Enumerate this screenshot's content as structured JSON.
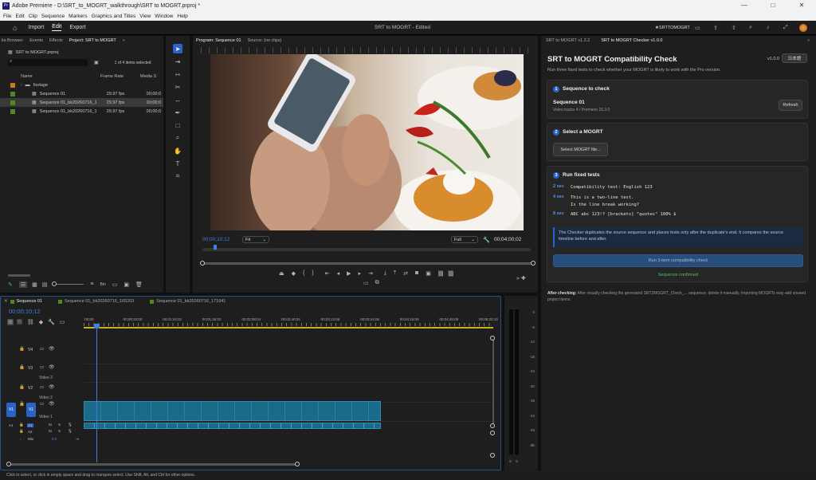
{
  "window": {
    "app": "Adobe Premiere",
    "path": "D:\\SRT_to_MOGRT_walkthrough\\SRT to MOGRT.prproj *",
    "controls": [
      "—",
      "□",
      "✕"
    ]
  },
  "menu": [
    "File",
    "Edit",
    "Clip",
    "Sequence",
    "Markers",
    "Graphics and Titles",
    "View",
    "Window",
    "Help"
  ],
  "header": {
    "workspaces": [
      "Import",
      "Edit",
      "Export"
    ],
    "active_workspace": "Edit",
    "doc_title": "SRT to MOGRT - Edited",
    "right_label": "★SRTTOMOGRT"
  },
  "project": {
    "tabs": [
      "lia Browser",
      "Events",
      "Effects",
      "Project: SRT to MOGRT"
    ],
    "file": "SRT to MOGRT.prproj",
    "selected_count": "1 of 4 items selected",
    "columns": [
      "Name",
      "Frame Rate",
      "Media S"
    ],
    "items": [
      {
        "name": "footage",
        "fps": "",
        "media": "",
        "color": "#c9771b"
      },
      {
        "name": "Sequence 01",
        "fps": "29.97 fps",
        "media": "00;00;0",
        "color": "#4f8a1f"
      },
      {
        "name": "Sequence 01_bk20260716_1",
        "fps": "29.97 fps",
        "media": "00;00;0",
        "color": "#4f8a1f"
      },
      {
        "name": "Sequence 01_bk20260716_1",
        "fps": "29.97 fps",
        "media": "00;00;0",
        "color": "#4f8a1f"
      }
    ]
  },
  "program": {
    "tabs": [
      "Program: Sequence 01",
      "Source: (no clips)"
    ],
    "timecode": "00;00;10;12",
    "fit": "Fit",
    "quality": "Full",
    "duration": "00;04;00;02"
  },
  "timeline": {
    "tabs": [
      "Sequence 01",
      "Sequence 01_bk20260716_165203",
      "Sequence 01_bk20260716_171641"
    ],
    "timecode": "00;00;10;12",
    "ruler": [
      ":00;00",
      "00;00;32;00",
      "00;01;04;02",
      "00;01;36;02",
      "00;02;08;04",
      "00;02;40;04",
      "00;03;12;06",
      "00;03;44;06",
      "00;04;16;08",
      "00;04;48;08",
      "00;05;20;10"
    ],
    "video_tracks": [
      {
        "id": "V4",
        "name": ""
      },
      {
        "id": "V3",
        "name": "Video 3"
      },
      {
        "id": "V2",
        "name": "Video 2"
      },
      {
        "id": "V1",
        "name": "Video 1"
      }
    ],
    "audio_tracks": [
      "A1",
      "A2"
    ],
    "mix_label": "Mix",
    "mix_value": "0.0",
    "source_patch": "V1"
  },
  "meters": {
    "scale": [
      "0",
      "-6",
      "-12",
      "-18",
      "-24",
      "-30",
      "-36",
      "-42",
      "-48",
      "dB"
    ],
    "bottom": [
      "S",
      "S"
    ]
  },
  "plugin": {
    "tabs": [
      "SRT to MOGRT v1.2.2",
      "SRT to MOGRT Checker v1.0.0"
    ],
    "title": "SRT to MOGRT Compatibility Check",
    "version": "v1.0.0",
    "lang_button": "日本語",
    "subtitle": "Run three fixed tests to check whether your MOGRT is likely to work with the Pro version.",
    "step1": {
      "num": "1",
      "title": "Sequence to check",
      "seq_name": "Sequence 01",
      "seq_info": "Video tracks 4 / Premiere 26.3.0",
      "refresh": "Refresh"
    },
    "step2": {
      "num": "2",
      "title": "Select a MOGRT",
      "button": "Select MOGRT file..."
    },
    "step3": {
      "num": "3",
      "title": "Run fixed tests",
      "tests": [
        {
          "time": "2 sec",
          "lines": [
            "Compatibility test: English 123"
          ]
        },
        {
          "time": "4 sec",
          "lines": [
            "This is a two-line test.",
            "Is the line break working?"
          ]
        },
        {
          "time": "8 sec",
          "lines": [
            "ABC abc 123!? [brackets] \"quotes\" 100% $"
          ]
        }
      ],
      "note": "The Checker duplicates the source sequence and places tests only after the duplicate's end. It compares the source timeline before and after.",
      "run_button": "Run 3-item compatibility check",
      "status": "Sequence confirmed"
    },
    "after_label": "After checking:",
    "after_text": "After visually checking the generated SRT2MOGRT_Check_... sequence, delete it manually. Importing MOGRTs may add unused project items."
  },
  "status_bar": "Click to select, or click in empty space and drag to marquee select. Use Shift, Alt, and Ctrl for other options.",
  "colors": {
    "accent": "#2a63c8",
    "clip": "#1b6a8a",
    "playhead": "#3f7fe0",
    "status_green": "#4fbf6a"
  }
}
